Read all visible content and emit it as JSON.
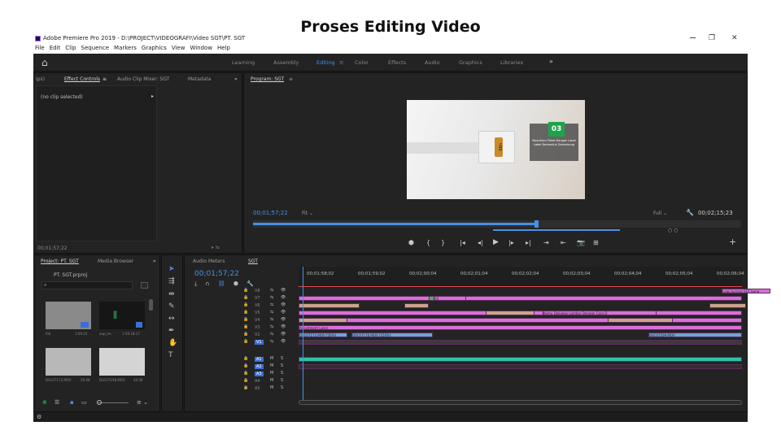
{
  "doc_title": "Proses Editing Video",
  "window": {
    "title": "Adobe Premiere Pro 2019 - D:\\PROJECT\\VIDEOGRAFI\\Video SGT\\PT. SGT",
    "controls": [
      "−",
      "❐",
      "✕"
    ]
  },
  "menu": [
    "File",
    "Edit",
    "Clip",
    "Sequence",
    "Markers",
    "Graphics",
    "View",
    "Window",
    "Help"
  ],
  "workspaces": [
    {
      "label": "Learning"
    },
    {
      "label": "Assembly"
    },
    {
      "label": "Editing",
      "active": true
    },
    {
      "label": "Color"
    },
    {
      "label": "Effects"
    },
    {
      "label": "Audio"
    },
    {
      "label": "Graphics"
    },
    {
      "label": "Libraries"
    }
  ],
  "workspace_menu_icon": "≡",
  "workspace_more": "»",
  "source_panel": {
    "tabs": [
      "ips)",
      "Effect Controls",
      "Audio Clip Mixer: SGT",
      "Metadata"
    ],
    "active_tab_icon": "≡",
    "more": "»",
    "no_clip": "(no clip selected)",
    "timecode": "00;01;57;22"
  },
  "program": {
    "tab": "Program: SGT",
    "tab_icon": "≡",
    "timecode": "00;01;57;22",
    "fit": "Fit",
    "quality": "Full",
    "duration": "00;02;15;23",
    "overlay_number": "03",
    "brand_text": "ugg",
    "caption_lines": [
      "Masukkan Paket Dengan Label",
      "Label Berbentuk Gelembung"
    ],
    "progress": 0.58
  },
  "transport": [
    "⬢",
    "{",
    "}",
    "|◂",
    "◂|",
    "▶",
    "|▸",
    "▸|",
    "⇥",
    "⇤",
    "📷",
    "⊞"
  ],
  "add_button": "+",
  "project": {
    "tabs": [
      "Project: PT. SGT",
      "Media Browser"
    ],
    "project_file": "PT. SGT.prproj",
    "search_placeholder": "",
    "items": [
      {
        "name": "Vid",
        "duration": "1:09:22"
      },
      {
        "name": "aup_en",
        "duration": "1:50:18:17"
      },
      {
        "name": "DSC07172.MOV",
        "duration": "29:08"
      },
      {
        "name": "DSC07198.MOV",
        "duration": "26:08"
      }
    ]
  },
  "timeline": {
    "tabs": [
      "Audio Meters",
      "SGT"
    ],
    "timecode": "00;01;57;22",
    "ruler": [
      "00;01;58;02",
      "00;01;59;02",
      "00;02;00;04",
      "00;02;01;04",
      "00;02;02;04",
      "00;02;03;04",
      "00;02;04;04",
      "00;02;05;04",
      "00;02;06;04"
    ],
    "video_tracks": [
      "V8",
      "V7",
      "V6",
      "V5",
      "V4",
      "V3",
      "V2",
      "V1"
    ],
    "audio_tracks": [
      "A1",
      "A2",
      "A3",
      "A4",
      "A5"
    ],
    "clips": {
      "logo": "Logo kurang SGT bane",
      "num": "04",
      "caption": "Kemu Dakukan Lambar Dengan Cara D",
      "adjust": "Adjustment Layer",
      "dsc1": "DSC07172.MOV [50%]",
      "dsc2": "DSC07176.MOV [150%]",
      "dsc3": "DSC07209.MOV",
      "cross": "Cross Dissolve"
    }
  },
  "colors": {
    "accent": "#4a8fe7",
    "clip_pink": "#d96fd9",
    "clip_tan": "#c9a48b",
    "clip_blue": "#6fa2d8",
    "audio_teal": "#2ec4a6",
    "playhead": "#e04848"
  }
}
